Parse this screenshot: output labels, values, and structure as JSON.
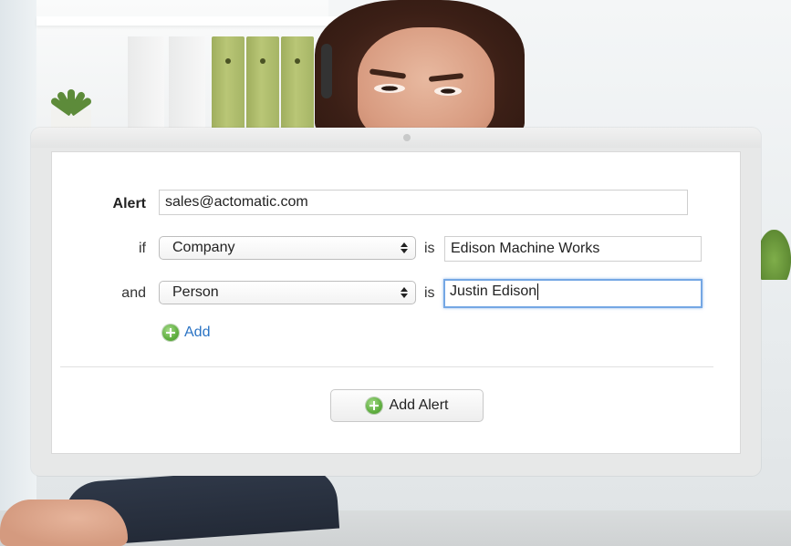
{
  "form": {
    "alert_label": "Alert",
    "alert_value": "sales@actomatic.com",
    "rules": [
      {
        "connector": "if",
        "field": "Company",
        "operator": "is",
        "value": "Edison Machine Works"
      },
      {
        "connector": "and",
        "field": "Person",
        "operator": "is",
        "value": "Justin Edison"
      }
    ],
    "add_rule_label": "Add",
    "submit_label": "Add Alert"
  },
  "icons": {
    "add_rule": "plus-circle-icon",
    "submit": "plus-circle-icon",
    "select_arrows": "up-down-arrows-icon"
  },
  "colors": {
    "link": "#2a73c4",
    "focus_ring": "#74a7e4",
    "add_icon": "#5fae3f"
  }
}
